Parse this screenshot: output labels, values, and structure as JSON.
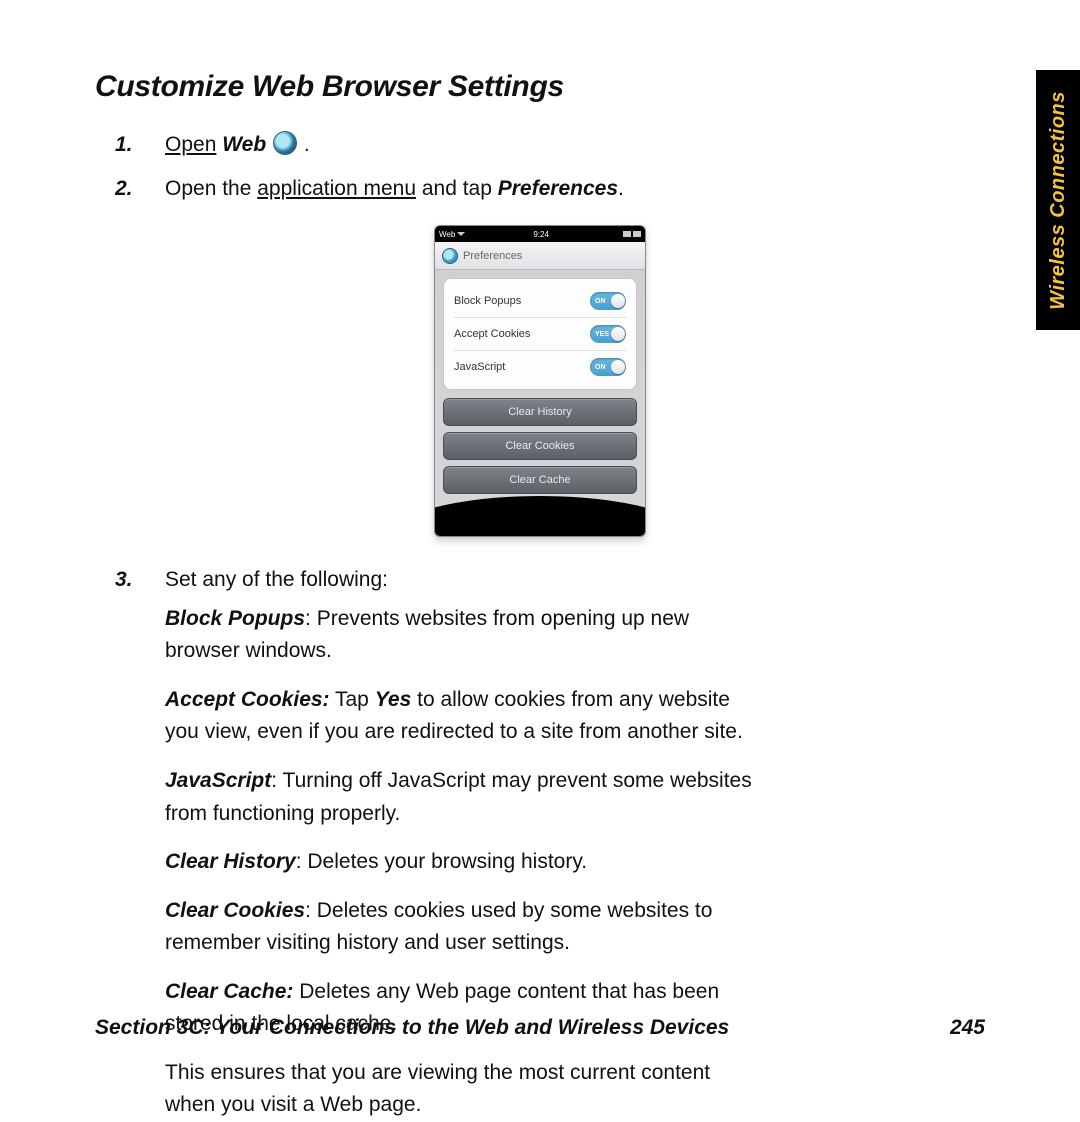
{
  "side_tab": "Wireless Connections",
  "title": "Customize Web Browser Settings",
  "step1": {
    "num": "1.",
    "open": "Open",
    "web": "Web",
    "period": "."
  },
  "step2": {
    "num": "2.",
    "a": "Open the ",
    "link": "application menu",
    "b": " and tap ",
    "pref": "Preferences",
    "period": "."
  },
  "phone": {
    "status_left": "Web",
    "status_time": "9:24",
    "prefs_title": "Preferences",
    "rows": {
      "block": "Block Popups",
      "cookies": "Accept Cookies",
      "js": "JavaScript",
      "toggle_block": "ON",
      "toggle_cookies": "YES",
      "toggle_js": "ON"
    },
    "buttons": {
      "history": "Clear History",
      "cookies": "Clear Cookies",
      "cache": "Clear Cache"
    }
  },
  "step3": {
    "num": "3.",
    "text": "Set any of the following:"
  },
  "defs": {
    "block_t": "Block Popups",
    "block_d": ": Prevents websites from opening up new browser windows.",
    "cookies_t": "Accept Cookies:",
    "cookies_a": " Tap ",
    "cookies_yes": "Yes",
    "cookies_b": " to allow cookies from any website you view, even if you are redirected to a site from another site.",
    "js_t": "JavaScript",
    "js_d": ": Turning off JavaScript may prevent some websites from functioning properly.",
    "hist_t": "Clear History",
    "hist_d": ": Deletes your browsing history.",
    "cc_t": "Clear Cookies",
    "cc_d": ": Deletes cookies used by some websites to remember visiting history and user settings.",
    "cache_t": "Clear Cache:",
    "cache_d": " Deletes any Web page content that has been stored in the local cache.",
    "ensure": "This ensures that you are viewing the most current content when you visit a Web page."
  },
  "footer": {
    "left": "Section 3C: Your Connections to the Web and Wireless Devices",
    "right": "245"
  }
}
